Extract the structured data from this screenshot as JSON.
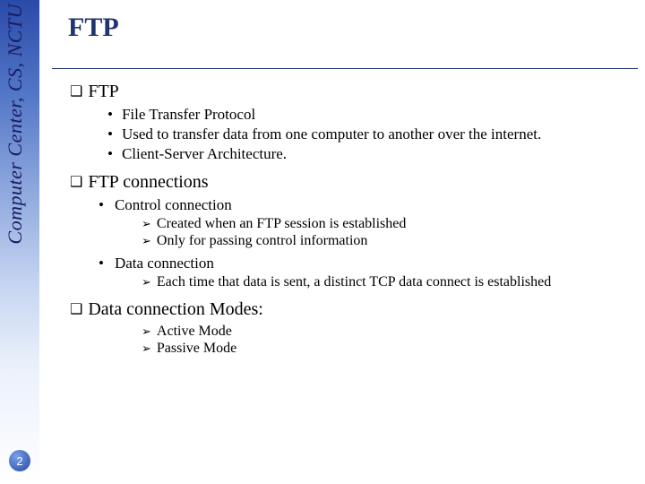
{
  "sidebar": {
    "org_text": "Computer Center, CS, NCTU",
    "page_number": "2"
  },
  "slide": {
    "title": "FTP",
    "sections": [
      {
        "heading": "FTP",
        "bullets": [
          "File Transfer Protocol",
          "Used to transfer data from one computer to another over the internet.",
          "Client-Server Architecture."
        ]
      },
      {
        "heading": "FTP connections",
        "subs": [
          {
            "label": "Control connection",
            "arrows": [
              "Created when an FTP session is established",
              "Only for passing control information"
            ]
          },
          {
            "label": "Data connection",
            "arrows": [
              "Each time that data is sent, a distinct TCP data connect is established"
            ]
          }
        ]
      },
      {
        "heading": "Data connection Modes:",
        "arrows": [
          "Active Mode",
          "Passive Mode"
        ]
      }
    ]
  }
}
